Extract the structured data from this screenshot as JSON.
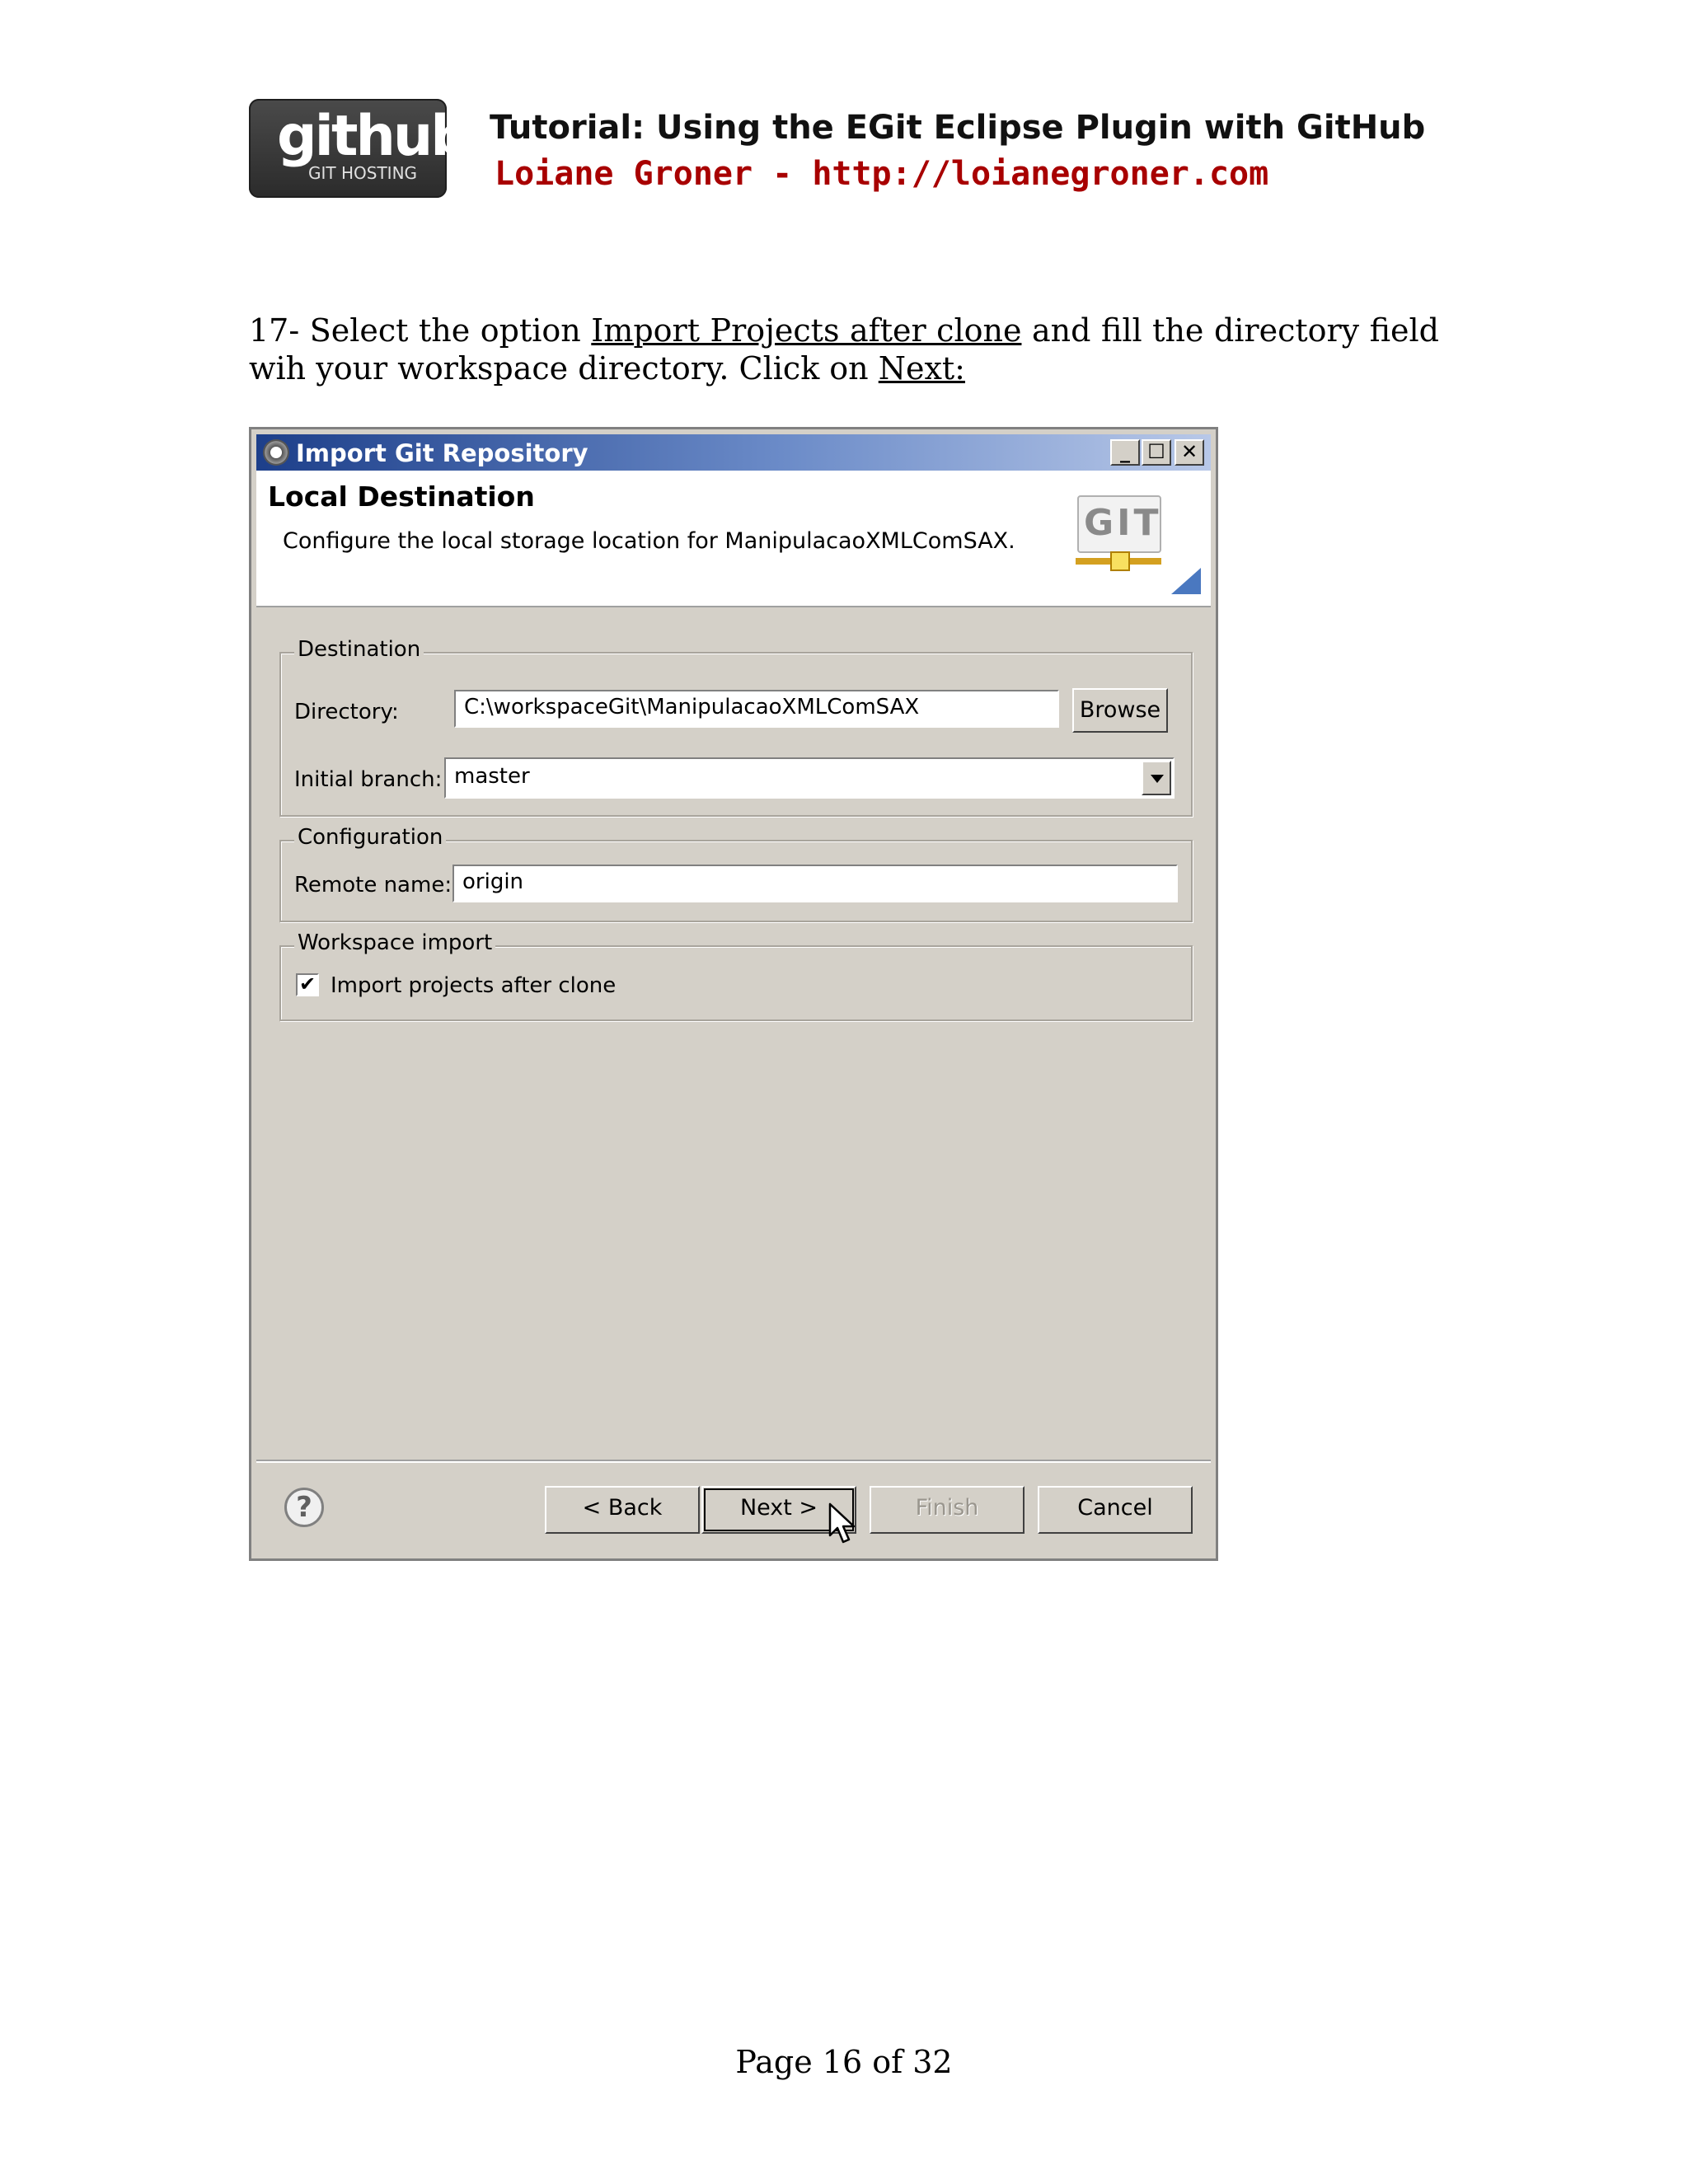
{
  "header": {
    "logo_text": "github",
    "logo_subtext": "GIT HOSTING",
    "title": "Tutorial: Using the EGit Eclipse Plugin with GitHub",
    "author_line": "Loiane Groner - http://loianegroner.com"
  },
  "instruction": {
    "prefix": "17- Select the option ",
    "option_link": "Import Projects after clone",
    "middle": " and fill the directory field wih your workspace directory. Click on ",
    "next_link": "Next:"
  },
  "dialog": {
    "title": "Import Git Repository",
    "window_buttons": {
      "minimize": "_",
      "maximize": "☐",
      "close": "✕"
    },
    "banner": {
      "title": "Local Destination",
      "description": "Configure the local storage location for ManipulacaoXMLComSAX.",
      "badge_text": "GIT"
    },
    "destination": {
      "legend": "Destination",
      "directory_label": "Directory:",
      "directory_value": "C:\\workspaceGit\\ManipulacaoXMLComSAX",
      "browse_label": "Browse",
      "branch_label": "Initial branch:",
      "branch_value": "master"
    },
    "configuration": {
      "legend": "Configuration",
      "remote_label": "Remote name:",
      "remote_value": "origin"
    },
    "workspace_import": {
      "legend": "Workspace import",
      "checkbox_label": "Import projects after clone",
      "checked": true,
      "check_glyph": "✔"
    },
    "buttons": {
      "back": "< Back",
      "next": "Next >",
      "finish": "Finish",
      "cancel": "Cancel"
    },
    "help_glyph": "?"
  },
  "footer": {
    "page_number": "Page 16 of 32"
  }
}
